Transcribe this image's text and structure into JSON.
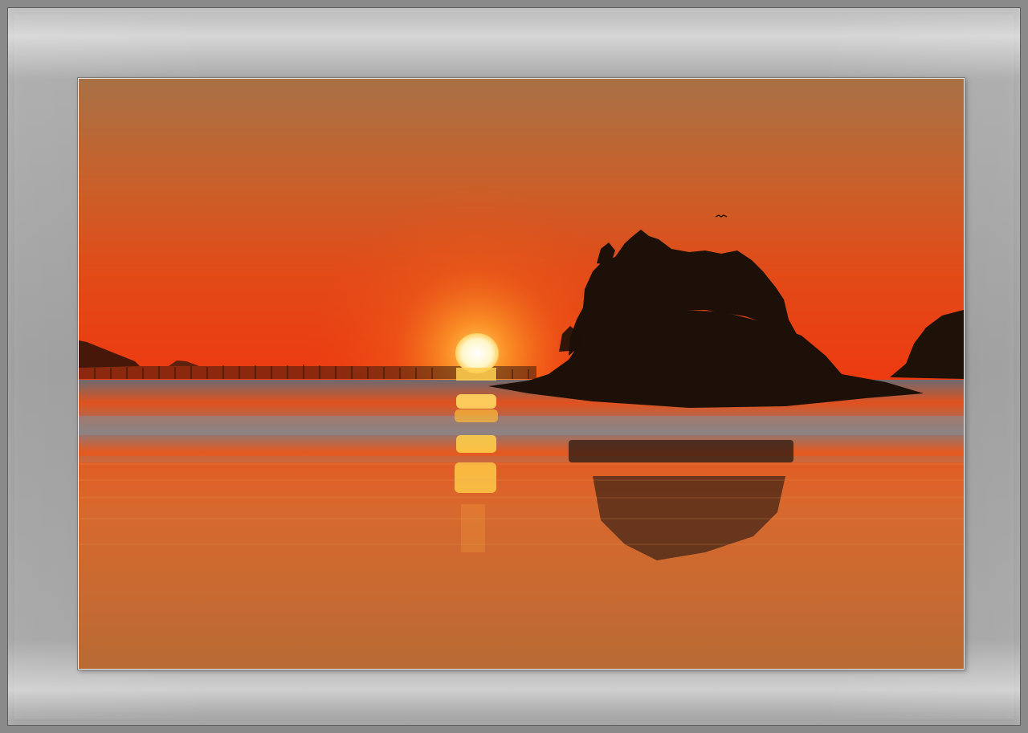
{
  "image": {
    "alt": "",
    "subject": "sunset-over-sea"
  },
  "colors": {
    "frame": "#9a9a9a",
    "sky_top": "#a96f45",
    "sky_mid": "#e2521c",
    "sky_horizon": "#f0380f",
    "sun": "#fff8d0",
    "water": "#c8692d",
    "silhouette": "#1c1008"
  }
}
